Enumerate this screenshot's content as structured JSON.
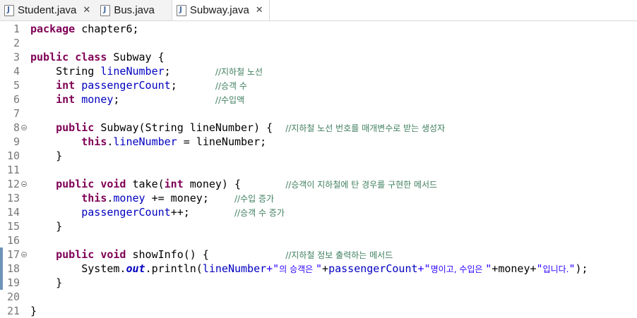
{
  "tabs": [
    {
      "label": "Student.java",
      "active": false,
      "closable": true
    },
    {
      "label": "Bus.java",
      "active": false,
      "closable": false
    },
    {
      "label": "Subway.java",
      "active": true,
      "closable": true
    }
  ],
  "close_glyph": "✕",
  "lines": [
    {
      "n": "1",
      "t": [
        [
          "kw",
          "package"
        ],
        [
          "",
          "&nbsp;chapter6;"
        ]
      ]
    },
    {
      "n": "2",
      "t": []
    },
    {
      "n": "3",
      "t": [
        [
          "kw",
          "public"
        ],
        [
          "",
          ""
        ],
        [
          "kw",
          "class"
        ],
        [
          "",
          "&nbsp;Subway {"
        ]
      ]
    },
    {
      "n": "4",
      "t": []
    },
    {
      "n": "5",
      "t": []
    }
  ],
  "code": {
    "l1": {
      "kw": "package",
      "rest": " chapter6;"
    },
    "l3": {
      "kw1": "public",
      "kw2": "class",
      "rest": " Subway {"
    },
    "l4": {
      "type": "String ",
      "field": "lineNumber",
      "semi": ";",
      "pad": "       ",
      "comment": "//지하철 노선"
    },
    "l5": {
      "type": "int",
      "sp": " ",
      "field": "passengerCount",
      "semi": ";",
      "pad": "      ",
      "comment": "//승객 수"
    },
    "l6": {
      "type": "int",
      "sp": " ",
      "field": "money",
      "semi": ";",
      "pad": "               ",
      "comment": "//수입액"
    },
    "l8": {
      "kw": "public",
      "rest1": " Subway(String ",
      "param": "lineNumber",
      "rest2": ") {  ",
      "comment": "//지하철 노선 번호를 매개변수로 받는 생성자"
    },
    "l9": {
      "kw": "this",
      "dot": ".",
      "field": "lineNumber",
      "rest1": " = ",
      "param": "lineNumber",
      "semi": ";"
    },
    "l10": "}",
    "l12": {
      "kw1": "public",
      "kw2": "void",
      "rest1": " take(",
      "kw3": "int",
      "rest2": " money) {       ",
      "comment": "//승객이 지하철에 탄 경우를 구현한 메서드"
    },
    "l13": {
      "kw": "this",
      "dot": ".",
      "field": "money",
      "rest": " += money;    ",
      "comment": "//수입 증가"
    },
    "l14": {
      "field": "passengerCount",
      "rest": "++;       ",
      "comment": "//승객 수 증가"
    },
    "l15": "}",
    "l17": {
      "kw1": "public",
      "kw2": "void",
      "rest": " showInfo() {            ",
      "comment": "//지하철 정보 출력하는 메서드"
    },
    "l18": {
      "p1": "System.",
      "stat": "out",
      "p2": ".println(",
      "f1": "lineNumber",
      "s1pre": "+\"",
      "s1kr": "의 승객은 ",
      "s1post": "\"",
      "p3": "+",
      "f2": "passengerCount",
      "s2pre": "+\"",
      "s2kr": "명이고, 수입은 ",
      "s2post": "\"",
      "p4": "+money+",
      "s3pre": "\"",
      "s3kr": "입니다.",
      "s3post": "\"",
      "p5": ");"
    },
    "l19": "}",
    "l21": "}"
  },
  "colors": {
    "keyword": "#7f0055",
    "field": "#0000c0",
    "comment": "#3f7f5f",
    "string": "#2a00ff",
    "line_number": "#787878"
  }
}
